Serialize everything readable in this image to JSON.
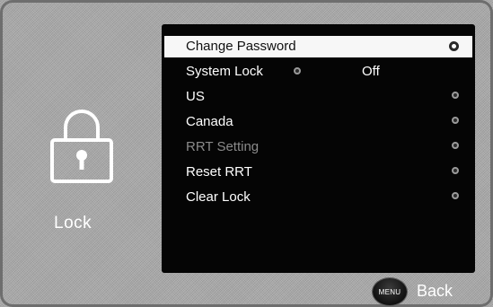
{
  "left_pane": {
    "icon": "lock-icon",
    "label": "Lock"
  },
  "menu": {
    "items": [
      {
        "label": "Change Password",
        "value": "",
        "state": "selected"
      },
      {
        "label": "System Lock",
        "value": "Off",
        "state": "normal"
      },
      {
        "label": "US",
        "value": "",
        "state": "normal"
      },
      {
        "label": "Canada",
        "value": "",
        "state": "normal"
      },
      {
        "label": "RRT Setting",
        "value": "",
        "state": "disabled"
      },
      {
        "label": "Reset RRT",
        "value": "",
        "state": "normal"
      },
      {
        "label": "Clear Lock",
        "value": "",
        "state": "normal"
      }
    ]
  },
  "footer": {
    "menu_button_label": "MENU",
    "back_label": "Back"
  },
  "colors": {
    "panel_background": "#050505",
    "selected_row": "#f7f7f7",
    "disabled_text": "#8a8a8a",
    "text": "#ffffff",
    "screen_background": "#a9a9a9"
  }
}
